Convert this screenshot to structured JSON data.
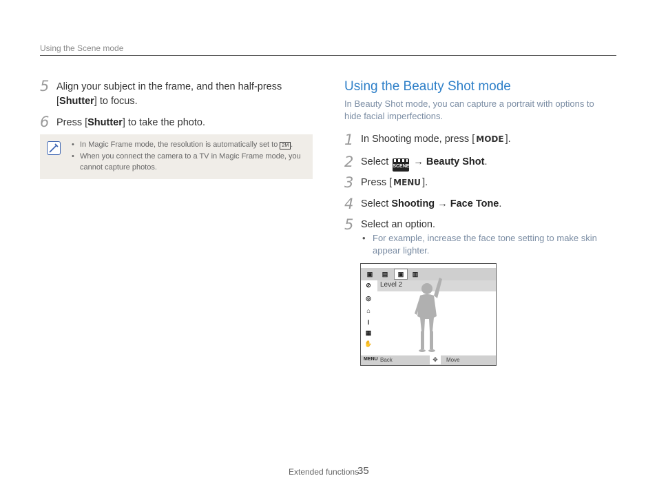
{
  "header": {
    "section": "Using the Scene mode"
  },
  "left": {
    "steps": [
      {
        "num": "5",
        "pre": "Align your subject in the frame, and then half-press [",
        "bold": "Shutter",
        "post": "] to focus."
      },
      {
        "num": "6",
        "pre": "Press [",
        "bold": "Shutter",
        "post": "] to take the photo."
      }
    ],
    "note": {
      "icon": "note-pencil-icon",
      "items": [
        "In Magic Frame mode, the resolution is automatically set to",
        "When you connect the camera to a TV in Magic Frame mode, you cannot capture photos."
      ],
      "resolution_icon": "2M",
      "item1_end": "."
    }
  },
  "right": {
    "title": "Using the Beauty Shot mode",
    "intro": "In Beauty Shot mode, you can capture a portrait with options to hide facial imperfections.",
    "steps": [
      {
        "num": "1",
        "pre": "In Shooting mode, press [",
        "glyph": "MODE",
        "post": "]."
      },
      {
        "num": "2",
        "pre": "Select",
        "icon": "SCENE",
        "arrow": "→",
        "bold": "Beauty Shot",
        "post": "."
      },
      {
        "num": "3",
        "pre": "Press [",
        "glyph": "MENU",
        "post": "]."
      },
      {
        "num": "4",
        "pre": "Select ",
        "bold1": "Shooting",
        "arrow": " → ",
        "bold2": "Face Tone",
        "post": "."
      },
      {
        "num": "5",
        "text": "Select an option."
      }
    ],
    "sub_bullet": "For example, increase the face tone setting to make skin appear lighter.",
    "camera": {
      "tabs": [
        "-",
        "-",
        "-",
        "-"
      ],
      "level": "Level 2",
      "menu_badge": "MENU",
      "back": "Back",
      "move": "Move"
    }
  },
  "footer": {
    "label": "Extended functions",
    "page": "35"
  }
}
